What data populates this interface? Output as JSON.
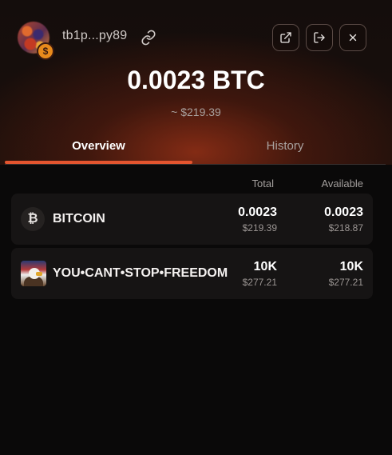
{
  "header": {
    "address": "tb1p...py89",
    "avatar_badge": "$",
    "buttons": {
      "open_external": "external-link-icon",
      "logout": "logout-icon",
      "close": "close-icon"
    }
  },
  "balance": {
    "amount": "0.0023 BTC",
    "usd": "~ $219.39"
  },
  "tabs": [
    {
      "label": "Overview",
      "active": true
    },
    {
      "label": "History",
      "active": false
    }
  ],
  "table": {
    "columns": [
      "Total",
      "Available"
    ],
    "rows": [
      {
        "icon": "bitcoin-icon",
        "icon_glyph": "₿",
        "name": "BITCOIN",
        "total": "0.0023",
        "total_usd": "$219.39",
        "available": "0.0023",
        "available_usd": "$218.87"
      },
      {
        "icon": "rune-eagle-icon",
        "name": "YOU•CANT•STOP•FREEDOM",
        "total": "10K",
        "total_usd": "$277.21",
        "available": "10K",
        "available_usd": "$277.21"
      }
    ]
  },
  "colors": {
    "accent": "#e4552f",
    "background": "#0a0909",
    "row": "#161414"
  }
}
